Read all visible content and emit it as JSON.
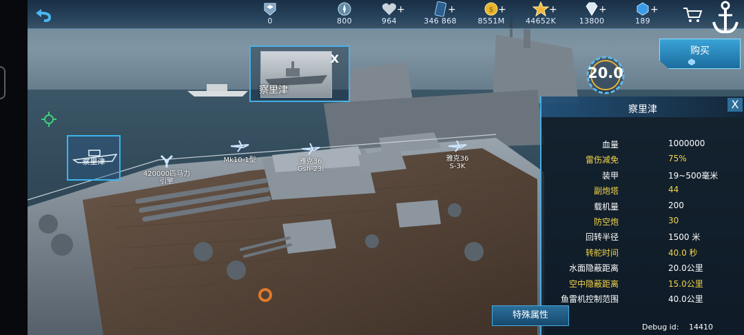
{
  "top_bar": {
    "resources": [
      {
        "icon": "rank-badge-icon",
        "value": "0",
        "has_plus": false
      },
      {
        "icon": "compass-token-icon",
        "value": "800",
        "has_plus": false
      },
      {
        "icon": "heart-icon",
        "value": "964",
        "has_plus": true
      },
      {
        "icon": "card-icon",
        "value": "346 868",
        "has_plus": true
      },
      {
        "icon": "gold-coin-icon",
        "value": "8551M",
        "has_plus": true
      },
      {
        "icon": "star-icon",
        "value": "44652K",
        "has_plus": true
      },
      {
        "icon": "diamond-icon",
        "value": "13800",
        "has_plus": true
      },
      {
        "icon": "blue-gem-icon",
        "value": "189",
        "has_plus": true
      }
    ],
    "plus_label": "+"
  },
  "target_card": {
    "name": "察里津",
    "close": "X"
  },
  "ship_tile": {
    "label": "察里津"
  },
  "weapon_tags": [
    {
      "line1": "420000匹马力",
      "line2": "引擎"
    },
    {
      "line1": "Mk10-1型",
      "line2": ""
    },
    {
      "line1": "雅克36",
      "line2": "Gsh-23l"
    },
    {
      "line1": "雅克36",
      "line2": "S-3K"
    }
  ],
  "speed": {
    "value": "20.0"
  },
  "buy_button": {
    "label": "购买"
  },
  "stats_panel": {
    "title": "察里津",
    "close": "X",
    "rows": [
      {
        "label": "血量",
        "value": "1000000",
        "highlight": false
      },
      {
        "label": "雷伤减免",
        "value": "75%",
        "highlight": true
      },
      {
        "label": "装甲",
        "value": "19~500毫米",
        "highlight": false
      },
      {
        "label": "副炮塔",
        "value": "44",
        "highlight": true
      },
      {
        "label": "载机量",
        "value": "200",
        "highlight": false
      },
      {
        "label": "防空炮",
        "value": "30",
        "highlight": true
      },
      {
        "label": "回转半径",
        "value": "1500 米",
        "highlight": false
      },
      {
        "label": "转舵时间",
        "value": "40.0 秒",
        "highlight": true
      },
      {
        "label": "水面隐蔽距离",
        "value": "20.0公里",
        "highlight": false
      },
      {
        "label": "空中隐蔽距离",
        "value": "15.0公里",
        "highlight": true
      },
      {
        "label": "鱼雷机控制范围",
        "value": "40.0公里",
        "highlight": false
      }
    ]
  },
  "special_tab": {
    "label": "特殊属性"
  },
  "debug": {
    "label": "Debug id:",
    "value": "14410"
  },
  "colors": {
    "accent": "#45aee6",
    "gold": "#f3d54a",
    "panel_bg": "#0a1420"
  }
}
